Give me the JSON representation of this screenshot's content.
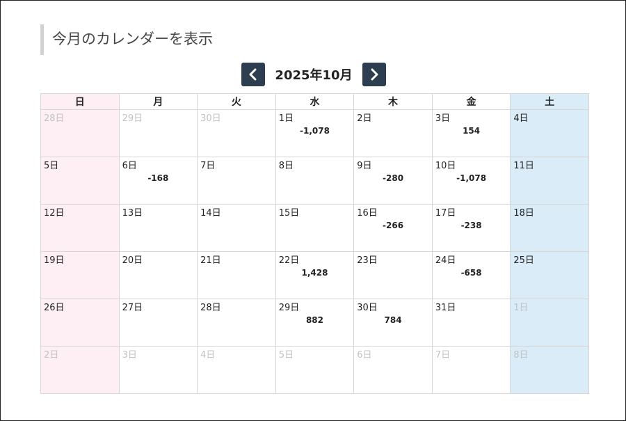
{
  "title": "今月のカレンダーを表示",
  "nav": {
    "month_label": "2025年10月"
  },
  "weekdays": [
    "日",
    "月",
    "火",
    "水",
    "木",
    "金",
    "土"
  ],
  "weeks": [
    [
      {
        "day": "28日",
        "amount": "",
        "other": true
      },
      {
        "day": "29日",
        "amount": "",
        "other": true
      },
      {
        "day": "30日",
        "amount": "",
        "other": true
      },
      {
        "day": "1日",
        "amount": "-1,078",
        "other": false
      },
      {
        "day": "2日",
        "amount": "",
        "other": false
      },
      {
        "day": "3日",
        "amount": "154",
        "other": false
      },
      {
        "day": "4日",
        "amount": "",
        "other": false
      }
    ],
    [
      {
        "day": "5日",
        "amount": "",
        "other": false
      },
      {
        "day": "6日",
        "amount": "-168",
        "other": false
      },
      {
        "day": "7日",
        "amount": "",
        "other": false
      },
      {
        "day": "8日",
        "amount": "",
        "other": false
      },
      {
        "day": "9日",
        "amount": "-280",
        "other": false
      },
      {
        "day": "10日",
        "amount": "-1,078",
        "other": false
      },
      {
        "day": "11日",
        "amount": "",
        "other": false
      }
    ],
    [
      {
        "day": "12日",
        "amount": "",
        "other": false
      },
      {
        "day": "13日",
        "amount": "",
        "other": false
      },
      {
        "day": "14日",
        "amount": "",
        "other": false
      },
      {
        "day": "15日",
        "amount": "",
        "other": false
      },
      {
        "day": "16日",
        "amount": "-266",
        "other": false
      },
      {
        "day": "17日",
        "amount": "-238",
        "other": false
      },
      {
        "day": "18日",
        "amount": "",
        "other": false
      }
    ],
    [
      {
        "day": "19日",
        "amount": "",
        "other": false
      },
      {
        "day": "20日",
        "amount": "",
        "other": false
      },
      {
        "day": "21日",
        "amount": "",
        "other": false
      },
      {
        "day": "22日",
        "amount": "1,428",
        "other": false
      },
      {
        "day": "23日",
        "amount": "",
        "other": false
      },
      {
        "day": "24日",
        "amount": "-658",
        "other": false
      },
      {
        "day": "25日",
        "amount": "",
        "other": false
      }
    ],
    [
      {
        "day": "26日",
        "amount": "",
        "other": false
      },
      {
        "day": "27日",
        "amount": "",
        "other": false
      },
      {
        "day": "28日",
        "amount": "",
        "other": false
      },
      {
        "day": "29日",
        "amount": "882",
        "other": false
      },
      {
        "day": "30日",
        "amount": "784",
        "other": false
      },
      {
        "day": "31日",
        "amount": "",
        "other": false
      },
      {
        "day": "1日",
        "amount": "",
        "other": true
      }
    ],
    [
      {
        "day": "2日",
        "amount": "",
        "other": true
      },
      {
        "day": "3日",
        "amount": "",
        "other": true
      },
      {
        "day": "4日",
        "amount": "",
        "other": true
      },
      {
        "day": "5日",
        "amount": "",
        "other": true
      },
      {
        "day": "6日",
        "amount": "",
        "other": true
      },
      {
        "day": "7日",
        "amount": "",
        "other": true
      },
      {
        "day": "8日",
        "amount": "",
        "other": true
      }
    ]
  ],
  "colors": {
    "nav_button": "#2c3e50",
    "sunday_bg": "#fdeff3",
    "saturday_bg": "#d9ecf7",
    "other_month_text": "#c2c2c2"
  },
  "icons": {
    "prev": "chevron-left-icon",
    "next": "chevron-right-icon"
  }
}
